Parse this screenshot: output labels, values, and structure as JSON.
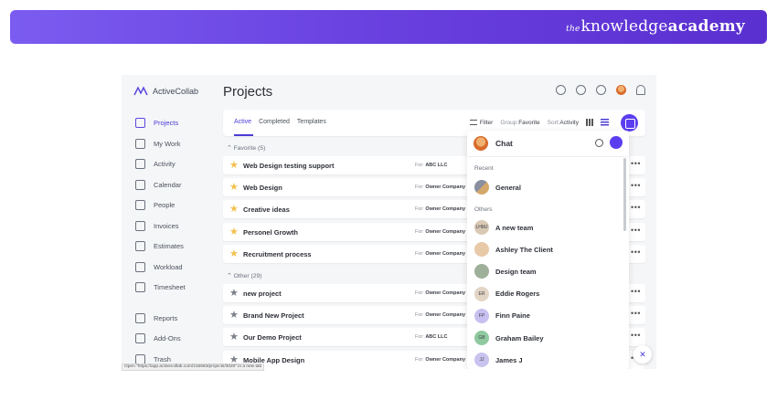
{
  "banner": {
    "brand_prefix": "the",
    "brand_main": "knowledge",
    "brand_bold": "academy"
  },
  "app": {
    "logo": "ActiveCollab",
    "title": "Projects",
    "sidebar": [
      {
        "label": "Projects",
        "icon": "projects-icon",
        "active": true
      },
      {
        "label": "My Work",
        "icon": "my-work-icon"
      },
      {
        "label": "Activity",
        "icon": "activity-icon"
      },
      {
        "label": "Calendar",
        "icon": "calendar-icon"
      },
      {
        "label": "People",
        "icon": "people-icon"
      },
      {
        "label": "Invoices",
        "icon": "invoices-icon"
      },
      {
        "label": "Estimates",
        "icon": "estimates-icon"
      },
      {
        "label": "Workload",
        "icon": "workload-icon"
      },
      {
        "label": "Timesheet",
        "icon": "timesheet-icon"
      },
      {
        "label": "Reports",
        "icon": "reports-icon"
      },
      {
        "label": "Add-Ons",
        "icon": "add-ons-icon"
      },
      {
        "label": "Trash",
        "icon": "trash-icon"
      }
    ],
    "tabs": [
      "Active",
      "Completed",
      "Templates"
    ],
    "toolbar": {
      "filter": "Filter",
      "group_label": "Group:",
      "group_value": "Favorite",
      "sort_label": "Sort:",
      "sort_value": "Activity"
    },
    "favorite_label": "Favorite (5)",
    "other_label": "Other (29)",
    "favorite_projects": [
      {
        "name": "Web Design testing support",
        "for": "For:",
        "client": "ABC LLC"
      },
      {
        "name": "Web Design",
        "for": "For:",
        "client": "Owner Company"
      },
      {
        "name": "Creative ideas",
        "for": "For:",
        "client": "Owner Company"
      },
      {
        "name": "Personel Growth",
        "for": "For:",
        "client": "Owner Company"
      },
      {
        "name": "Recruitment process",
        "for": "For:",
        "client": "Owner Company"
      }
    ],
    "other_projects": [
      {
        "name": "new project",
        "for": "For:",
        "client": "Owner Company"
      },
      {
        "name": "Brand New Project",
        "for": "For:",
        "client": "Owner Company"
      },
      {
        "name": "Our Demo Project",
        "for": "For:",
        "client": "ABC LLC"
      },
      {
        "name": "Mobile App Design",
        "for": "For:",
        "client": "Owner Company"
      }
    ],
    "row_menu": "•••"
  },
  "chat": {
    "title": "Chat",
    "recent_label": "Recent",
    "others_label": "Others",
    "recent": [
      {
        "name": "General",
        "avatar": ""
      }
    ],
    "others": [
      {
        "name": "A new team",
        "avatar": "LHMJ",
        "color": "#d9c8b4"
      },
      {
        "name": "Ashley The Client",
        "avatar": "",
        "color": "#e8c9a8"
      },
      {
        "name": "Design team",
        "avatar": "",
        "color": "#9fb09a"
      },
      {
        "name": "Eddie Rogers",
        "avatar": "ER",
        "color": "#e3d5c5"
      },
      {
        "name": "Finn Paine",
        "avatar": "FP",
        "color": "#c7c0f0"
      },
      {
        "name": "Graham Bailey",
        "avatar": "GB",
        "color": "#8fc9a0"
      },
      {
        "name": "James J",
        "avatar": "JJ",
        "color": "#c9c3ef"
      }
    ],
    "close": "✕"
  },
  "status_url": "Open “https://app.activecollab.com/216663/projects/3020” in a new tab"
}
